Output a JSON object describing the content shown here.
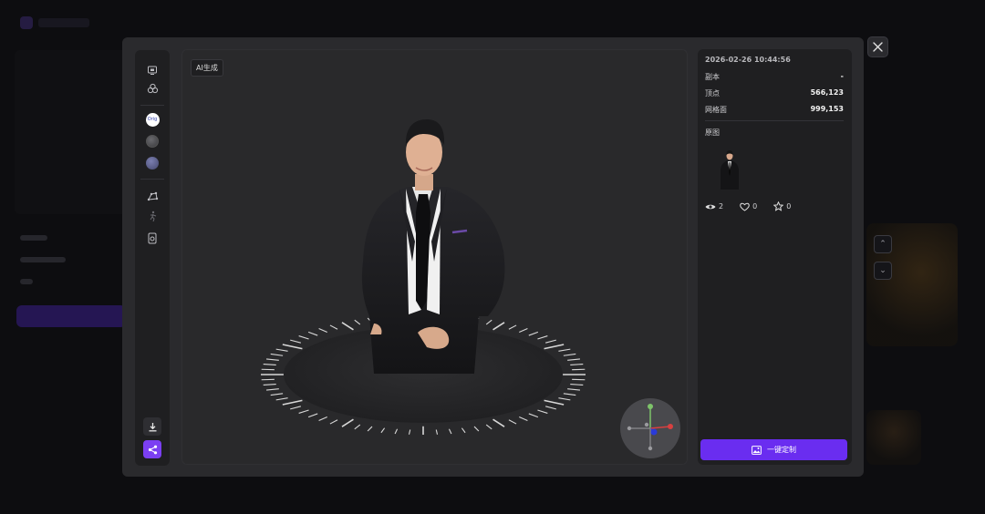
{
  "modal": {
    "viewport": {
      "tag": "AI生成"
    },
    "toolbar": {
      "tools": [
        {
          "name": "camera-icon"
        },
        {
          "name": "layers-icon"
        },
        {
          "name": "material-original-icon",
          "label": "Orig"
        },
        {
          "name": "material-gray-icon"
        },
        {
          "name": "material-blue-icon"
        },
        {
          "name": "bone-icon"
        },
        {
          "name": "pose-icon"
        },
        {
          "name": "document-icon"
        }
      ],
      "download": {
        "name": "download-icon"
      },
      "share": {
        "name": "share-icon",
        "color": "#7b3ff2"
      }
    },
    "info": {
      "date": "2026-02-26 10:44:56",
      "rows": [
        {
          "label": "副本",
          "value": "-"
        },
        {
          "label": "顶点",
          "value": "566,123"
        },
        {
          "label": "网格面",
          "value": "999,153"
        }
      ],
      "original_label": "原图",
      "stats": {
        "views": "2",
        "likes": "0",
        "favorites": "0"
      },
      "customize_label": "一键定制",
      "accent_color": "#6a2df0"
    }
  }
}
